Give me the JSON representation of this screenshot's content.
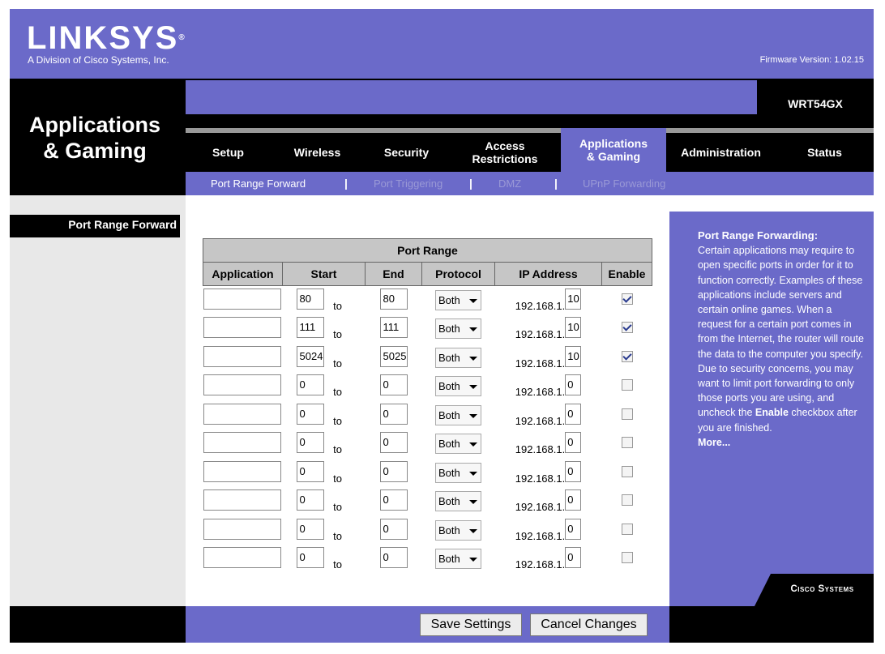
{
  "header": {
    "logo": "LINKSYS",
    "logo_mark": "®",
    "subtitle": "A Division of Cisco Systems, Inc.",
    "firmware": "Firmware Version: 1.02.15",
    "model": "WRT54GX",
    "section_title_line1": "Applications",
    "section_title_line2": "& Gaming"
  },
  "tabs": [
    {
      "l1": "Setup",
      "l2": ""
    },
    {
      "l1": "Wireless",
      "l2": ""
    },
    {
      "l1": "Security",
      "l2": ""
    },
    {
      "l1": "Access",
      "l2": "Restrictions"
    },
    {
      "l1": "Applications",
      "l2": "& Gaming"
    },
    {
      "l1": "Administration",
      "l2": ""
    },
    {
      "l1": "Status",
      "l2": ""
    }
  ],
  "subnav": [
    "Port Range Forward",
    "Port Triggering",
    "DMZ",
    "UPnP Forwarding"
  ],
  "subnav_sep": "|",
  "sidebar": {
    "heading": "Port Range Forward"
  },
  "table": {
    "group_header": "Port Range",
    "columns": [
      "Application",
      "Start",
      "End",
      "Protocol",
      "IP Address",
      "Enable"
    ],
    "to_label": "to",
    "ip_prefix": "192.168.1.",
    "rows": [
      {
        "app": "",
        "start": "80",
        "end": "80",
        "protocol": "Both",
        "ip": "10",
        "enabled": true
      },
      {
        "app": "",
        "start": "111",
        "end": "111",
        "protocol": "Both",
        "ip": "10",
        "enabled": true
      },
      {
        "app": "",
        "start": "5024",
        "end": "5025",
        "protocol": "Both",
        "ip": "10",
        "enabled": true
      },
      {
        "app": "",
        "start": "0",
        "end": "0",
        "protocol": "Both",
        "ip": "0",
        "enabled": false
      },
      {
        "app": "",
        "start": "0",
        "end": "0",
        "protocol": "Both",
        "ip": "0",
        "enabled": false
      },
      {
        "app": "",
        "start": "0",
        "end": "0",
        "protocol": "Both",
        "ip": "0",
        "enabled": false
      },
      {
        "app": "",
        "start": "0",
        "end": "0",
        "protocol": "Both",
        "ip": "0",
        "enabled": false
      },
      {
        "app": "",
        "start": "0",
        "end": "0",
        "protocol": "Both",
        "ip": "0",
        "enabled": false
      },
      {
        "app": "",
        "start": "0",
        "end": "0",
        "protocol": "Both",
        "ip": "0",
        "enabled": false
      },
      {
        "app": "",
        "start": "0",
        "end": "0",
        "protocol": "Both",
        "ip": "0",
        "enabled": false
      }
    ]
  },
  "help": {
    "title": "Port Range Forwarding:",
    "body1": "Certain applications may require to open specific ports in order for it to function correctly. Examples of these applications include servers and certain online games. When a request for a certain port comes in from the Internet, the router will route the data to the computer you specify. Due to security concerns, you may want to limit port forwarding to only those ports you are using, and uncheck the",
    "bold_word": "Enable",
    "body2": "checkbox after you are finished.",
    "more": "More..."
  },
  "brand": {
    "cisco": "Cisco Systems"
  },
  "buttons": {
    "save": "Save Settings",
    "cancel": "Cancel Changes"
  },
  "colors": {
    "brand_purple": "#6b6ac9",
    "header_black": "#000000",
    "table_header": "#c6c6c6"
  }
}
